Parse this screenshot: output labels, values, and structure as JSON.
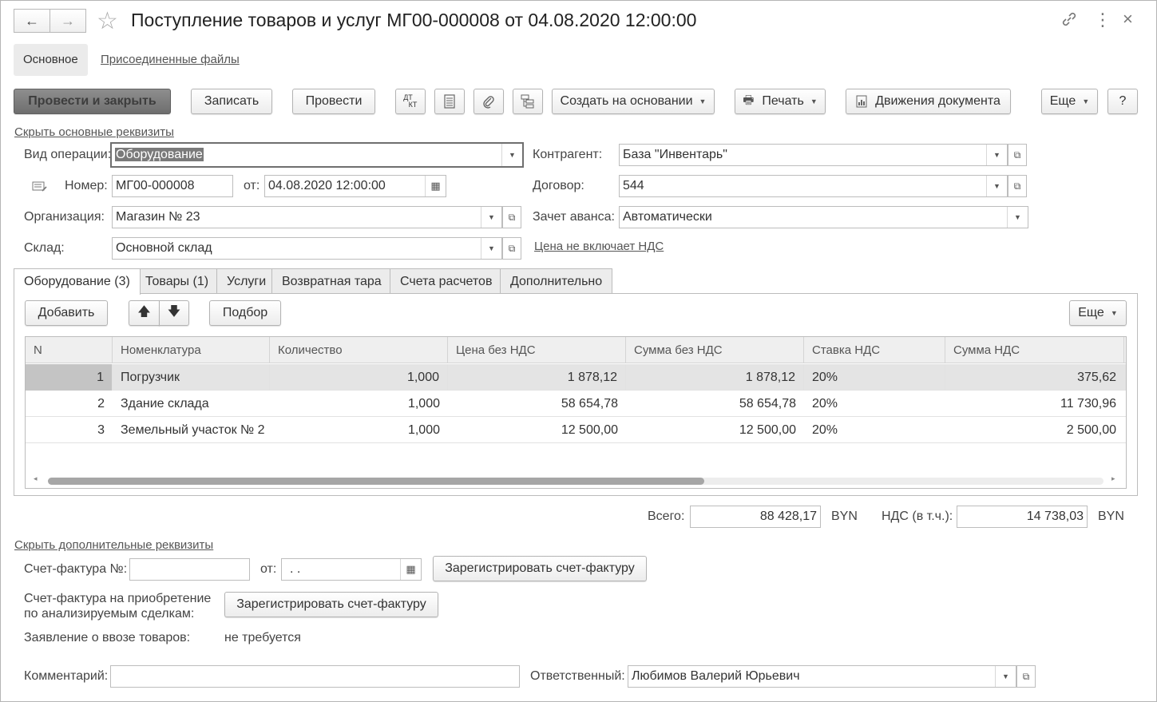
{
  "header": {
    "title": "Поступление товаров и услуг МГ00-000008 от 04.08.2020 12:00:00",
    "back_icon": "←",
    "forward_icon": "→",
    "star_icon": "☆",
    "link_icon": "🔗",
    "more_icon": "⋮",
    "close_icon": "×"
  },
  "top_tabs": {
    "main": "Основное",
    "files": "Присоединенные файлы"
  },
  "toolbar": {
    "post_close": "Провести и закрыть",
    "save": "Записать",
    "post": "Провести",
    "dtkt_top": "ДТ",
    "dtkt_bottom": "КТ",
    "create_based": "Создать на основании",
    "print": "Печать",
    "movements": "Движения документа",
    "more": "Еще",
    "help": "?"
  },
  "form": {
    "hide_main_link": "Скрыть основные реквизиты",
    "op_type_label": "Вид операции:",
    "op_type_value": "Оборудование",
    "number_label": "Номер:",
    "number_value": "МГ00-000008",
    "date_label": "от:",
    "date_value": "04.08.2020 12:00:00",
    "org_label": "Организация:",
    "org_value": "Магазин № 23",
    "warehouse_label": "Склад:",
    "warehouse_value": "Основной склад",
    "counterparty_label": "Контрагент:",
    "counterparty_value": "База \"Инвентарь\"",
    "contract_label": "Договор:",
    "contract_value": "544",
    "advance_label": "Зачет аванса:",
    "advance_value": "Автоматически",
    "vat_link": "Цена не включает НДС"
  },
  "tabs": [
    "Оборудование (3)",
    "Товары (1)",
    "Услуги",
    "Возвратная тара",
    "Счета расчетов",
    "Дополнительно"
  ],
  "table_toolbar": {
    "add": "Добавить",
    "up": "🡅",
    "down": "🡇",
    "pick": "Подбор",
    "more": "Еще"
  },
  "table": {
    "columns": [
      "N",
      "Номенклатура",
      "Количество",
      "Цена без НДС",
      "Сумма без НДС",
      "Ставка НДС",
      "Сумма НДС"
    ],
    "rows": [
      [
        "1",
        "Погрузчик",
        "1,000",
        "1 878,12",
        "1 878,12",
        "20%",
        "375,62"
      ],
      [
        "2",
        "Здание склада",
        "1,000",
        "58 654,78",
        "58 654,78",
        "20%",
        "11 730,96"
      ],
      [
        "3",
        "Земельный участок № 2",
        "1,000",
        "12 500,00",
        "12 500,00",
        "20%",
        "2 500,00"
      ]
    ]
  },
  "totals": {
    "total_label": "Всего:",
    "total_value": "88 428,17",
    "currency": "BYN",
    "vat_label": "НДС (в т.ч.):",
    "vat_value": "14 738,03",
    "vat_currency": "BYN"
  },
  "extra": {
    "hide_extra_link": "Скрыть дополнительные реквизиты",
    "invoice_label": "Счет-фактура №:",
    "invoice_value": "",
    "invoice_date_label": "от:",
    "invoice_date_value": ". .",
    "register_invoice": "Зарегистрировать счет-фактуру",
    "analyzed_label_1": "Счет-фактура на приобретение",
    "analyzed_label_2": "по анализируемым сделкам:",
    "register_invoice_2": "Зарегистрировать счет-фактуру",
    "import_label": "Заявление о ввозе товаров:",
    "import_value": "не требуется",
    "comment_label": "Комментарий:",
    "comment_value": "",
    "responsible_label": "Ответственный:",
    "responsible_value": "Любимов Валерий Юрьевич"
  }
}
